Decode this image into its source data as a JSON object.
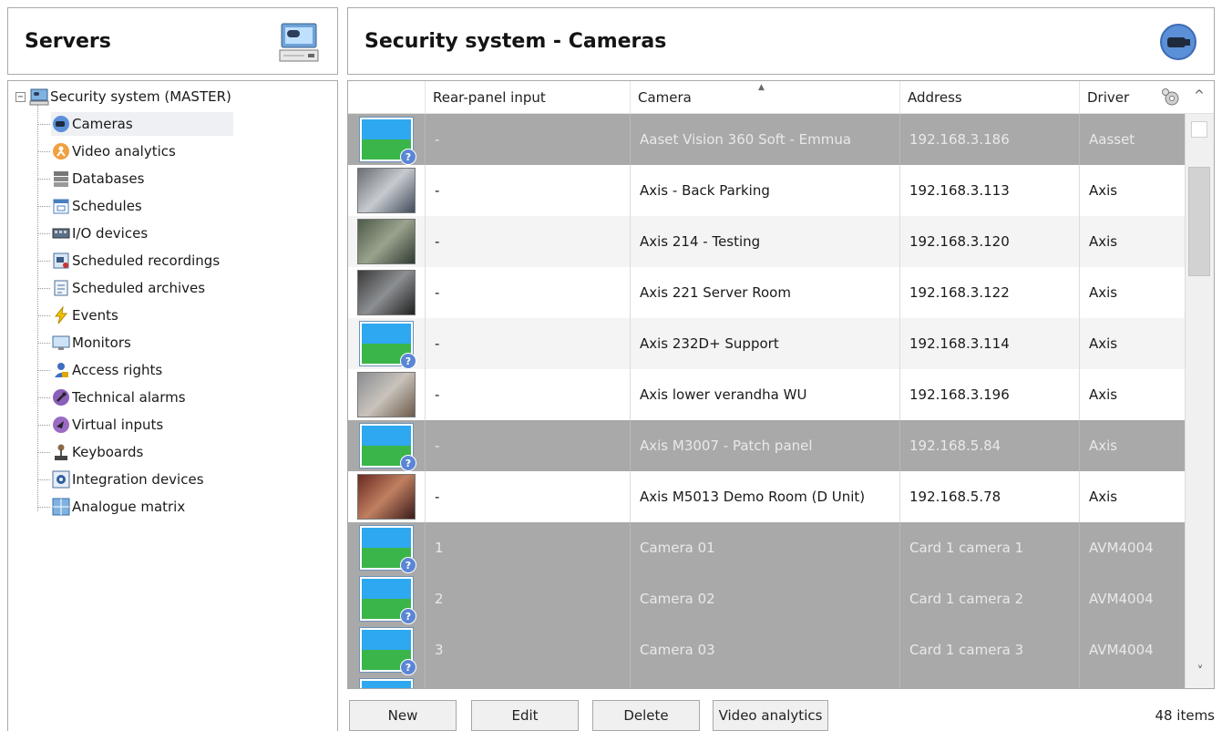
{
  "servers_panel": {
    "title": "Servers",
    "icon": "server-monitor-icon"
  },
  "main_header": {
    "title": "Security system - Cameras",
    "icon": "camera-icon"
  },
  "tree": {
    "root": {
      "label": "Security system (MASTER)",
      "icon": "server-icon",
      "expander": "−"
    },
    "items": [
      {
        "label": "Cameras",
        "icon": "camera-icon",
        "selected": true
      },
      {
        "label": "Video analytics",
        "icon": "video-analytics-icon"
      },
      {
        "label": "Databases",
        "icon": "database-icon"
      },
      {
        "label": "Schedules",
        "icon": "calendar-icon"
      },
      {
        "label": "I/O devices",
        "icon": "io-device-icon"
      },
      {
        "label": "Scheduled recordings",
        "icon": "scheduled-recording-icon"
      },
      {
        "label": "Scheduled archives",
        "icon": "scheduled-archive-icon"
      },
      {
        "label": "Events",
        "icon": "lightning-icon"
      },
      {
        "label": "Monitors",
        "icon": "monitor-icon"
      },
      {
        "label": "Access rights",
        "icon": "user-lock-icon"
      },
      {
        "label": "Technical alarms",
        "icon": "wrench-icon"
      },
      {
        "label": "Virtual inputs",
        "icon": "virtual-input-icon"
      },
      {
        "label": "Keyboards",
        "icon": "joystick-icon"
      },
      {
        "label": "Integration devices",
        "icon": "gear-icon"
      },
      {
        "label": "Analogue matrix",
        "icon": "grid-icon"
      }
    ]
  },
  "grid": {
    "columns": {
      "rear": "Rear-panel input",
      "camera": "Camera",
      "address": "Address",
      "driver": "Driver"
    },
    "sort_indicator": "▲",
    "settings_icon": "column-settings-icon",
    "rows": [
      {
        "thumb": "placeholder",
        "rear": "-",
        "camera": "Aaset Vision 360 Soft - Emmua",
        "address": "192.168.3.186",
        "driver": "Aasset",
        "state": "gray"
      },
      {
        "thumb": "live",
        "rear": "-",
        "camera": "Axis - Back Parking",
        "address": "192.168.3.113",
        "driver": "Axis",
        "state": "white"
      },
      {
        "thumb": "live",
        "rear": "-",
        "camera": "Axis 214 - Testing",
        "address": "192.168.3.120",
        "driver": "Axis",
        "state": "light"
      },
      {
        "thumb": "live",
        "rear": "-",
        "camera": "Axis 221 Server Room",
        "address": "192.168.3.122",
        "driver": "Axis",
        "state": "white"
      },
      {
        "thumb": "placeholder",
        "rear": "-",
        "camera": "Axis 232D+ Support",
        "address": "192.168.3.114",
        "driver": "Axis",
        "state": "light"
      },
      {
        "thumb": "live",
        "rear": "-",
        "camera": "Axis lower verandha WU",
        "address": "192.168.3.196",
        "driver": "Axis",
        "state": "white"
      },
      {
        "thumb": "placeholder",
        "rear": "-",
        "camera": "Axis M3007 - Patch panel",
        "address": "192.168.5.84",
        "driver": "Axis",
        "state": "gray"
      },
      {
        "thumb": "live",
        "rear": "-",
        "camera": "Axis M5013 Demo Room (D Unit)",
        "address": "192.168.5.78",
        "driver": "Axis",
        "state": "white"
      },
      {
        "thumb": "placeholder",
        "rear": "1",
        "camera": "Camera 01",
        "address": "Card 1 camera 1",
        "driver": "AVM4004",
        "state": "gray"
      },
      {
        "thumb": "placeholder",
        "rear": "2",
        "camera": "Camera 02",
        "address": "Card 1 camera 2",
        "driver": "AVM4004",
        "state": "gray"
      },
      {
        "thumb": "placeholder",
        "rear": "3",
        "camera": "Camera 03",
        "address": "Card 1 camera 3",
        "driver": "AVM4004",
        "state": "gray"
      },
      {
        "thumb": "placeholder",
        "rear": "",
        "camera": "",
        "address": "",
        "driver": "",
        "state": "gray"
      }
    ]
  },
  "buttons": {
    "new": "New",
    "edit": "Edit",
    "delete": "Delete",
    "analytics": "Video analytics"
  },
  "status": {
    "items": "48 items"
  }
}
